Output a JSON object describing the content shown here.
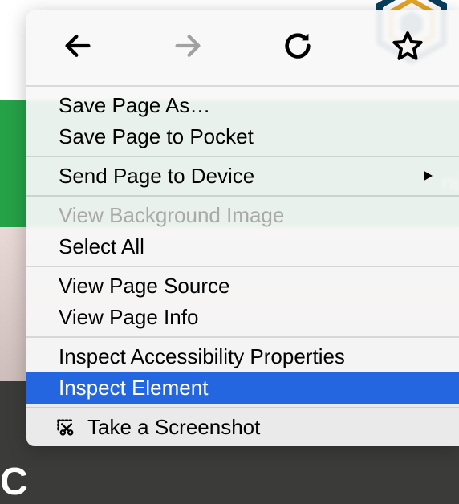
{
  "toolbar": {
    "back": "Back",
    "forward": "Forward",
    "reload": "Reload",
    "bookmark": "Bookmark"
  },
  "menu": {
    "save_page_as": "Save Page As…",
    "save_to_pocket": "Save Page to Pocket",
    "send_to_device": "Send Page to Device",
    "view_bg_image": "View Background Image",
    "select_all": "Select All",
    "view_source": "View Page Source",
    "view_info": "View Page Info",
    "inspect_a11y": "Inspect Accessibility Properties",
    "inspect_element": "Inspect Element",
    "take_screenshot": "Take a Screenshot"
  },
  "bg": {
    "partial_right": "ni",
    "partial_bottom_left": "C"
  }
}
